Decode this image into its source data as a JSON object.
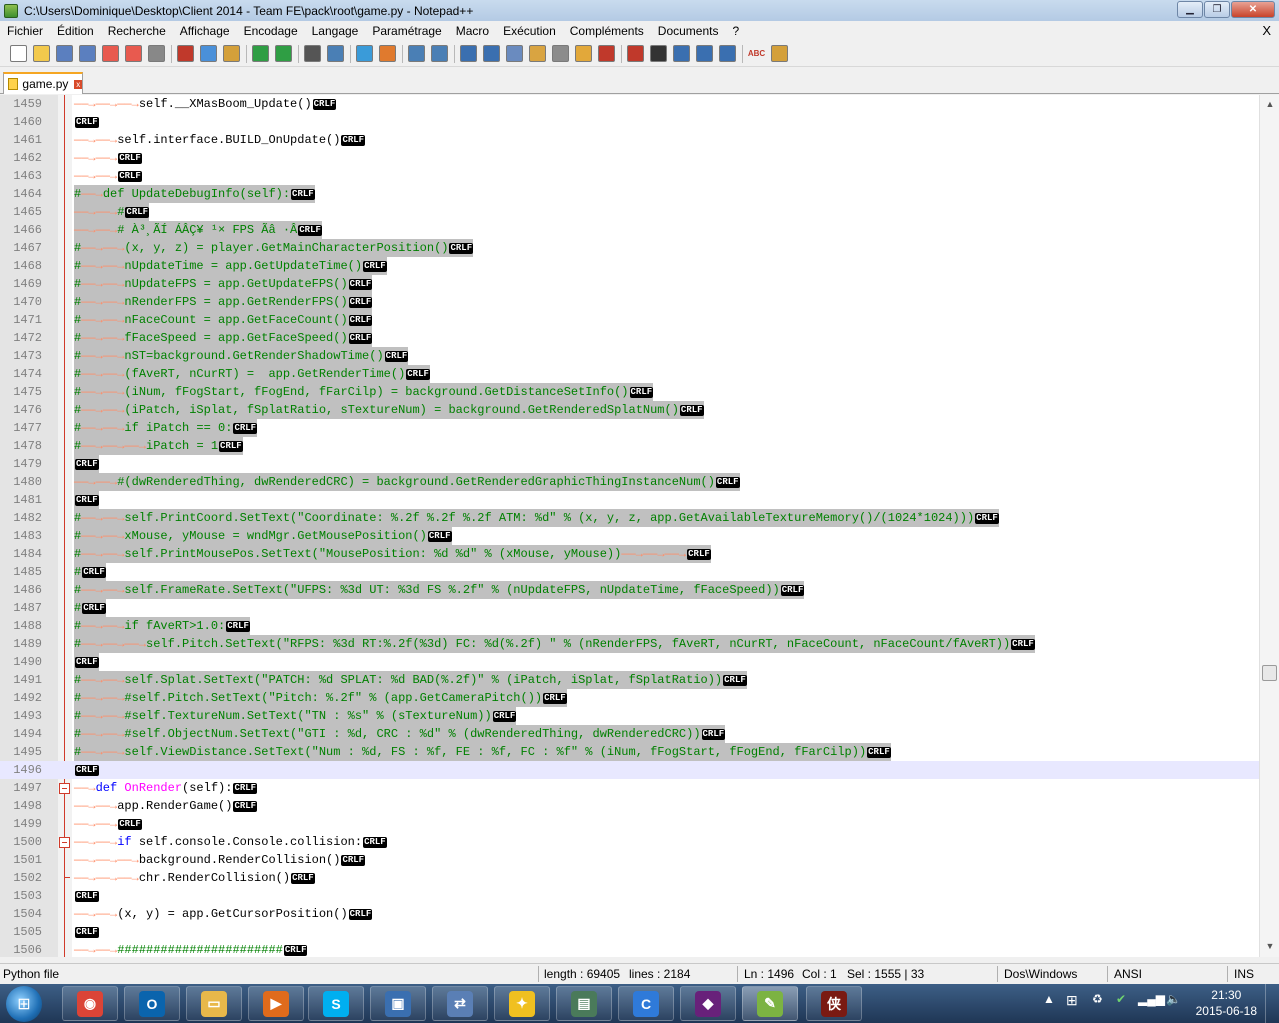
{
  "window": {
    "title": "C:\\Users\\Dominique\\Desktop\\Client 2014 - Team FE\\pack\\root\\game.py - Notepad++"
  },
  "menu": {
    "items": [
      "Fichier",
      "Édition",
      "Recherche",
      "Affichage",
      "Encodage",
      "Langage",
      "Paramétrage",
      "Macro",
      "Exécution",
      "Compléments",
      "Documents",
      "?"
    ],
    "close_glyph": "X"
  },
  "toolbar": {
    "icons": [
      "new-file-icon",
      "open-file-icon",
      "save-icon",
      "save-all-icon",
      "close-icon",
      "close-all-icon",
      "print-icon",
      "cut-icon",
      "copy-icon",
      "paste-icon",
      "undo-icon",
      "redo-icon",
      "find-icon",
      "replace-icon",
      "zoom-in-icon",
      "zoom-out-icon",
      "sync-vertical-icon",
      "sync-horizontal-icon",
      "word-wrap-icon",
      "show-all-chars-icon",
      "indent-guide-icon",
      "lang-udl-icon",
      "doc-map-icon",
      "function-list-icon",
      "folder-workspace-icon",
      "record-macro-icon",
      "stop-macro-icon",
      "play-macro-icon",
      "run-macro-multiple-icon",
      "save-macro-icon",
      "spellcheck-icon",
      "compare-icon"
    ],
    "spellcheck_label": "ABC"
  },
  "tab": {
    "label": "game.py",
    "close_glyph": "x"
  },
  "eol": {
    "cr": "CR",
    "lf": "LF"
  },
  "editor": {
    "lines": [
      {
        "n": "1459",
        "text": "→→→self.__XMasBoom_Update()",
        "style": "plain"
      },
      {
        "n": "1460",
        "text": "",
        "style": "plain"
      },
      {
        "n": "1461",
        "text": "→→self.interface.BUILD_OnUpdate()",
        "style": "plain"
      },
      {
        "n": "1462",
        "text": "→→",
        "style": "plain"
      },
      {
        "n": "1463",
        "text": "→→",
        "style": "plain"
      },
      {
        "n": "1464",
        "text": "#→def UpdateDebugInfo(self):",
        "style": "sel"
      },
      {
        "n": "1465",
        "text": "→→#",
        "style": "sel"
      },
      {
        "n": "1466",
        "text": "→→# À³¸ÃÍ ÁÂÇ¥ ¹× FPS Ãâ ·Â",
        "style": "sel"
      },
      {
        "n": "1467",
        "text": "#→→(x, y, z) = player.GetMainCharacterPosition()",
        "style": "sel"
      },
      {
        "n": "1468",
        "text": "#→→nUpdateTime = app.GetUpdateTime()",
        "style": "sel"
      },
      {
        "n": "1469",
        "text": "#→→nUpdateFPS = app.GetUpdateFPS()",
        "style": "sel"
      },
      {
        "n": "1470",
        "text": "#→→nRenderFPS = app.GetRenderFPS()",
        "style": "sel"
      },
      {
        "n": "1471",
        "text": "#→→nFaceCount = app.GetFaceCount()",
        "style": "sel"
      },
      {
        "n": "1472",
        "text": "#→→fFaceSpeed = app.GetFaceSpeed()",
        "style": "sel"
      },
      {
        "n": "1473",
        "text": "#→→nST=background.GetRenderShadowTime()",
        "style": "sel"
      },
      {
        "n": "1474",
        "text": "#→→(fAveRT, nCurRT) =  app.GetRenderTime()",
        "style": "sel"
      },
      {
        "n": "1475",
        "text": "#→→(iNum, fFogStart, fFogEnd, fFarCilp) = background.GetDistanceSetInfo()",
        "style": "sel"
      },
      {
        "n": "1476",
        "text": "#→→(iPatch, iSplat, fSplatRatio, sTextureNum) = background.GetRenderedSplatNum()",
        "style": "sel"
      },
      {
        "n": "1477",
        "text": "#→→if iPatch == 0:",
        "style": "sel"
      },
      {
        "n": "1478",
        "text": "#→→→iPatch = 1",
        "style": "sel"
      },
      {
        "n": "1479",
        "text": "",
        "style": "sel"
      },
      {
        "n": "1480",
        "text": "→→#(dwRenderedThing, dwRenderedCRC) = background.GetRenderedGraphicThingInstanceNum()",
        "style": "sel"
      },
      {
        "n": "1481",
        "text": "",
        "style": "sel"
      },
      {
        "n": "1482",
        "text": "#→→self.PrintCoord.SetText(\"Coordinate: %.2f %.2f %.2f ATM: %d\" % (x, y, z, app.GetAvailableTextureMemory()/(1024*1024)))",
        "style": "sel"
      },
      {
        "n": "1483",
        "text": "#→→xMouse, yMouse = wndMgr.GetMousePosition()",
        "style": "sel"
      },
      {
        "n": "1484",
        "text": "#→→self.PrintMousePos.SetText(\"MousePosition: %d %d\" % (xMouse, yMouse))→→→",
        "style": "sel"
      },
      {
        "n": "1485",
        "text": "#",
        "style": "sel"
      },
      {
        "n": "1486",
        "text": "#→→self.FrameRate.SetText(\"UFPS: %3d UT: %3d FS %.2f\" % (nUpdateFPS, nUpdateTime, fFaceSpeed))",
        "style": "sel"
      },
      {
        "n": "1487",
        "text": "#",
        "style": "sel"
      },
      {
        "n": "1488",
        "text": "#→→if fAveRT>1.0:",
        "style": "sel"
      },
      {
        "n": "1489",
        "text": "#→→→self.Pitch.SetText(\"RFPS: %3d RT:%.2f(%3d) FC: %d(%.2f) \" % (nRenderFPS, fAveRT, nCurRT, nFaceCount, nFaceCount/fAveRT))",
        "style": "sel"
      },
      {
        "n": "1490",
        "text": "",
        "style": "sel"
      },
      {
        "n": "1491",
        "text": "#→→self.Splat.SetText(\"PATCH: %d SPLAT: %d BAD(%.2f)\" % (iPatch, iSplat, fSplatRatio))",
        "style": "sel"
      },
      {
        "n": "1492",
        "text": "#→→#self.Pitch.SetText(\"Pitch: %.2f\" % (app.GetCameraPitch())",
        "style": "sel"
      },
      {
        "n": "1493",
        "text": "#→→#self.TextureNum.SetText(\"TN : %s\" % (sTextureNum))",
        "style": "sel"
      },
      {
        "n": "1494",
        "text": "#→→#self.ObjectNum.SetText(\"GTI : %d, CRC : %d\" % (dwRenderedThing, dwRenderedCRC))",
        "style": "sel"
      },
      {
        "n": "1495",
        "text": "#→→self.ViewDistance.SetText(\"Num : %d, FS : %f, FE : %f, FC : %f\" % (iNum, fFogStart, fFogEnd, fFarCilp))",
        "style": "sel"
      },
      {
        "n": "1496",
        "text": "",
        "style": "caret"
      },
      {
        "n": "1497",
        "text": "→def OnRender(self):",
        "style": "def"
      },
      {
        "n": "1498",
        "text": "→→app.RenderGame()",
        "style": "plain"
      },
      {
        "n": "1499",
        "text": "→→",
        "style": "plain"
      },
      {
        "n": "1500",
        "text": "→→if self.console.Console.collision:",
        "style": "if"
      },
      {
        "n": "1501",
        "text": "→→→background.RenderCollision()",
        "style": "plain"
      },
      {
        "n": "1502",
        "text": "→→→chr.RenderCollision()",
        "style": "plain"
      },
      {
        "n": "1503",
        "text": "",
        "style": "plain"
      },
      {
        "n": "1504",
        "text": "→→(x, y) = app.GetCursorPosition()",
        "style": "plain"
      },
      {
        "n": "1505",
        "text": "",
        "style": "plain"
      },
      {
        "n": "1506",
        "text": "→→#######################",
        "style": "cmt"
      }
    ]
  },
  "status": {
    "file_type": "Python file",
    "length": "length : 69405",
    "lines": "lines : 2184",
    "ln": "Ln : 1496",
    "col": "Col : 1",
    "sel": "Sel : 1555 | 33",
    "eol_mode": "Dos\\Windows",
    "encoding": "ANSI",
    "ins": "INS"
  },
  "taskbar": {
    "apps": [
      {
        "name": "chrome",
        "color": "#db4437",
        "glyph": "◉"
      },
      {
        "name": "outlook",
        "color": "#0a64ad",
        "glyph": "O"
      },
      {
        "name": "explorer",
        "color": "#e8b84a",
        "glyph": "▭"
      },
      {
        "name": "media-player",
        "color": "#e06b1c",
        "glyph": "▶"
      },
      {
        "name": "skype",
        "color": "#00aff0",
        "glyph": "S"
      },
      {
        "name": "virtualbox",
        "color": "#3a6fb0",
        "glyph": "▣"
      },
      {
        "name": "network-tool",
        "color": "#5a7fb5",
        "glyph": "⇄"
      },
      {
        "name": "game-launcher",
        "color": "#f0c020",
        "glyph": "✦"
      },
      {
        "name": "remote-desktop",
        "color": "#4a7a5a",
        "glyph": "▤"
      },
      {
        "name": "ccleaner",
        "color": "#2f7ad9",
        "glyph": "C"
      },
      {
        "name": "visual-studio",
        "color": "#68217a",
        "glyph": "◆"
      },
      {
        "name": "notepad-plus-plus",
        "color": "#7cb342",
        "glyph": "✎"
      },
      {
        "name": "metin2-client",
        "color": "#7a1a12",
        "glyph": "侠"
      }
    ],
    "tray_up": "▲",
    "time": "21:30",
    "date": "2015-06-18"
  }
}
